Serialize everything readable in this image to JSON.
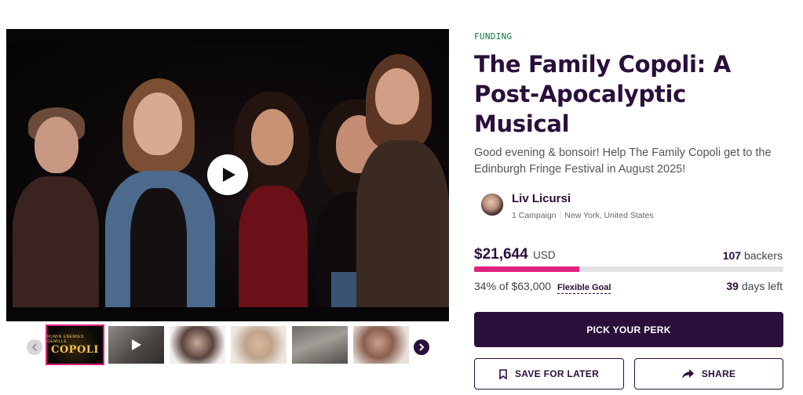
{
  "media": {
    "thumbnail_logo_small": "RUMIN ENEMIES GEMILLE",
    "thumbnail_logo_big": "COPOLI"
  },
  "campaign": {
    "status_label": "FUNDING",
    "title": "The Family Copoli: A Post-Apocalyptic Musical",
    "tagline": "Good evening & bonsoir! Help The Family Copoli get to the Edinburgh Fringe Festival in August 2025!"
  },
  "creator": {
    "name": "Liv Licursi",
    "campaigns": "1 Campaign",
    "location": "New York, United States"
  },
  "funding": {
    "raised": "$21,644",
    "currency": "USD",
    "backers_count": "107",
    "backers_label": "backers",
    "percent_label": "34% of $63,000",
    "progress_fraction": 0.34,
    "flexible_goal_label": "Flexible Goal",
    "days_left_count": "39",
    "days_left_label": "days left"
  },
  "actions": {
    "pick_perk": "PICK YOUR PERK",
    "save_for_later": "SAVE FOR LATER",
    "share": "SHARE"
  },
  "icons": {
    "play": "play-icon",
    "prev": "chevron-left-icon",
    "next": "chevron-right-icon",
    "bookmark": "bookmark-icon",
    "share": "share-arrow-icon"
  },
  "colors": {
    "brand_dark": "#2a0f3a",
    "progress": "#e0247d",
    "funding_green": "#0c7a3c"
  }
}
